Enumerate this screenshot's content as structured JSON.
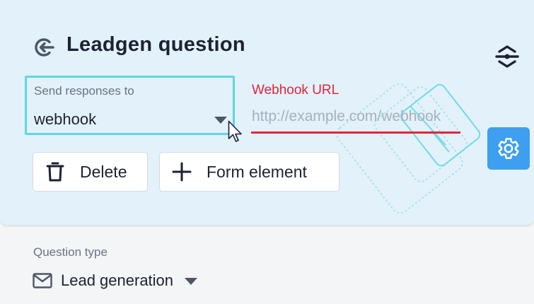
{
  "header": {
    "title": "Leadgen question",
    "icon": "exit-circle-icon",
    "collapse_icon": "collapse-icon"
  },
  "responses_select": {
    "label": "Send responses to",
    "value": "webhook"
  },
  "webhook": {
    "label": "Webhook URL",
    "placeholder": "http://example.com/webhook",
    "value": ""
  },
  "actions": {
    "delete_label": "Delete",
    "form_element_label": "Form element",
    "settings_icon": "gear-icon"
  },
  "question_type": {
    "label": "Question type",
    "value": "Lead generation",
    "icon": "envelope-icon"
  },
  "colors": {
    "card_bg": "#e3f1fb",
    "accent_cyan": "#5ed6e5",
    "error_red": "#e1253a",
    "primary_blue": "#3e9ff0",
    "text_dark": "#1d2233",
    "text_muted": "#6a7282"
  }
}
